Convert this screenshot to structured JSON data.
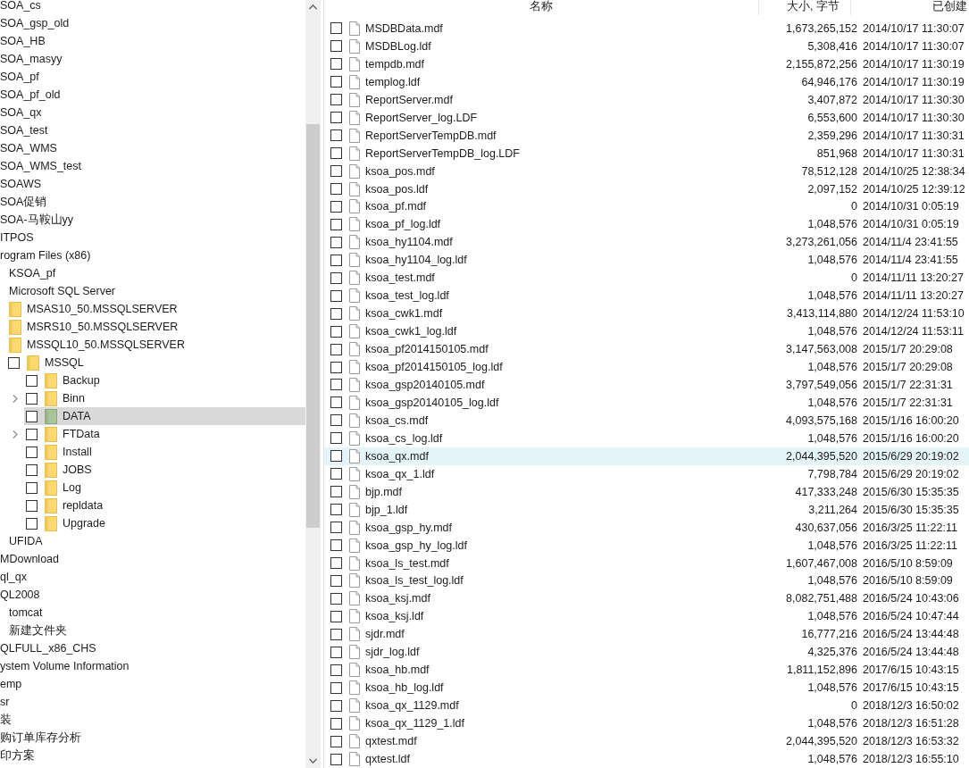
{
  "tree": {
    "items": [
      {
        "label": "SOA_cs",
        "selected": false
      },
      {
        "label": "SOA_gsp_old",
        "selected": false
      },
      {
        "label": "SOA_HB",
        "selected": false
      },
      {
        "label": "SOA_masyy",
        "selected": false
      },
      {
        "label": "SOA_pf",
        "selected": false
      },
      {
        "label": "SOA_pf_old",
        "selected": false
      },
      {
        "label": "SOA_qx",
        "selected": false
      },
      {
        "label": "SOA_test",
        "selected": false
      },
      {
        "label": "SOA_WMS",
        "selected": false
      },
      {
        "label": "SOA_WMS_test",
        "selected": false
      },
      {
        "label": "SOAWS",
        "selected": false
      },
      {
        "label": "SOA促销",
        "selected": false
      },
      {
        "label": "SOA-马鞍山yy",
        "selected": false
      },
      {
        "label": "ITPOS",
        "selected": false
      },
      {
        "label": "rogram Files (x86)",
        "selected": false,
        "children": [
          {
            "label": "KSOA_pf",
            "selected": false
          },
          {
            "label": "Microsoft SQL Server",
            "selected": false,
            "children": [
              {
                "label": "MSAS10_50.MSSQLSERVER",
                "selected": false
              },
              {
                "label": "MSRS10_50.MSSQLSERVER",
                "selected": false
              },
              {
                "label": "MSSQL10_50.MSSQLSERVER",
                "selected": false,
                "children": [
                  {
                    "label": "MSSQL",
                    "selected": false,
                    "checked": false,
                    "children": [
                      {
                        "label": "Backup",
                        "selected": false,
                        "checked": false,
                        "expandable": false
                      },
                      {
                        "label": "Binn",
                        "selected": false,
                        "checked": false,
                        "expandable": true
                      },
                      {
                        "label": "DATA",
                        "selected": true,
                        "checked": false,
                        "expandable": false
                      },
                      {
                        "label": "FTData",
                        "selected": false,
                        "checked": false,
                        "expandable": true
                      },
                      {
                        "label": "Install",
                        "selected": false,
                        "checked": false,
                        "expandable": false
                      },
                      {
                        "label": "JOBS",
                        "selected": false,
                        "checked": false,
                        "expandable": false
                      },
                      {
                        "label": "Log",
                        "selected": false,
                        "checked": false,
                        "expandable": false
                      },
                      {
                        "label": "repldata",
                        "selected": false,
                        "checked": false,
                        "expandable": false
                      },
                      {
                        "label": "Upgrade",
                        "selected": false,
                        "checked": false,
                        "expandable": false
                      }
                    ]
                  }
                ]
              }
            ]
          },
          {
            "label": "UFIDA",
            "selected": false
          }
        ]
      },
      {
        "label": "MDownload",
        "selected": false
      },
      {
        "label": "ql_qx",
        "selected": false
      },
      {
        "label": "QL2008",
        "selected": false,
        "children": [
          {
            "label": "tomcat",
            "selected": false
          },
          {
            "label": "新建文件夹",
            "selected": false
          }
        ]
      },
      {
        "label": "QLFULL_x86_CHS",
        "selected": false
      },
      {
        "label": "ystem Volume Information",
        "selected": false
      },
      {
        "label": "emp",
        "selected": false
      },
      {
        "label": "sr",
        "selected": false
      },
      {
        "label": "装",
        "selected": false
      },
      {
        "label": "购订单库存分析",
        "selected": false
      },
      {
        "label": "印方案",
        "selected": false
      }
    ]
  },
  "file_list": {
    "columns": [
      "名称",
      "大小, 字节",
      "已创建"
    ],
    "rows": [
      {
        "name": "MSDBData.mdf",
        "size": "1,673,265,152",
        "created": "2014/10/17 11:30:07",
        "checked": false,
        "selected": false
      },
      {
        "name": "MSDBLog.ldf",
        "size": "5,308,416",
        "created": "2014/10/17 11:30:07",
        "checked": false,
        "selected": false
      },
      {
        "name": "tempdb.mdf",
        "size": "2,155,872,256",
        "created": "2014/10/17 11:30:19",
        "checked": false,
        "selected": false
      },
      {
        "name": "templog.ldf",
        "size": "64,946,176",
        "created": "2014/10/17 11:30:19",
        "checked": false,
        "selected": false
      },
      {
        "name": "ReportServer.mdf",
        "size": "3,407,872",
        "created": "2014/10/17 11:30:30",
        "checked": false,
        "selected": false
      },
      {
        "name": "ReportServer_log.LDF",
        "size": "6,553,600",
        "created": "2014/10/17 11:30:30",
        "checked": false,
        "selected": false
      },
      {
        "name": "ReportServerTempDB.mdf",
        "size": "2,359,296",
        "created": "2014/10/17 11:30:31",
        "checked": false,
        "selected": false
      },
      {
        "name": "ReportServerTempDB_log.LDF",
        "size": "851,968",
        "created": "2014/10/17 11:30:31",
        "checked": false,
        "selected": false
      },
      {
        "name": "ksoa_pos.mdf",
        "size": "78,512,128",
        "created": "2014/10/25 12:38:34",
        "checked": false,
        "selected": false
      },
      {
        "name": "ksoa_pos.ldf",
        "size": "2,097,152",
        "created": "2014/10/25 12:39:12",
        "checked": false,
        "selected": false
      },
      {
        "name": "ksoa_pf.mdf",
        "size": "0",
        "created": "2014/10/31 0:05:19",
        "checked": false,
        "selected": false
      },
      {
        "name": "ksoa_pf_log.ldf",
        "size": "1,048,576",
        "created": "2014/10/31 0:05:19",
        "checked": false,
        "selected": false
      },
      {
        "name": "ksoa_hy1104.mdf",
        "size": "3,273,261,056",
        "created": "2014/11/4 23:41:55",
        "checked": false,
        "selected": false
      },
      {
        "name": "ksoa_hy1104_log.ldf",
        "size": "1,048,576",
        "created": "2014/11/4 23:41:55",
        "checked": false,
        "selected": false
      },
      {
        "name": "ksoa_test.mdf",
        "size": "0",
        "created": "2014/11/11 13:20:27",
        "checked": false,
        "selected": false
      },
      {
        "name": "ksoa_test_log.ldf",
        "size": "1,048,576",
        "created": "2014/11/11 13:20:27",
        "checked": false,
        "selected": false
      },
      {
        "name": "ksoa_cwk1.mdf",
        "size": "3,413,114,880",
        "created": "2014/12/24 11:53:10",
        "checked": false,
        "selected": false
      },
      {
        "name": "ksoa_cwk1_log.ldf",
        "size": "1,048,576",
        "created": "2014/12/24 11:53:11",
        "checked": false,
        "selected": false
      },
      {
        "name": "ksoa_pf2014150105.mdf",
        "size": "3,147,563,008",
        "created": "2015/1/7 20:29:08",
        "checked": false,
        "selected": false
      },
      {
        "name": "ksoa_pf2014150105_log.ldf",
        "size": "1,048,576",
        "created": "2015/1/7 20:29:08",
        "checked": false,
        "selected": false
      },
      {
        "name": "ksoa_gsp20140105.mdf",
        "size": "3,797,549,056",
        "created": "2015/1/7 22:31:31",
        "checked": false,
        "selected": false
      },
      {
        "name": "ksoa_gsp20140105_log.ldf",
        "size": "1,048,576",
        "created": "2015/1/7 22:31:31",
        "checked": false,
        "selected": false
      },
      {
        "name": "ksoa_cs.mdf",
        "size": "4,093,575,168",
        "created": "2015/1/16 16:00:20",
        "checked": false,
        "selected": false
      },
      {
        "name": "ksoa_cs_log.ldf",
        "size": "1,048,576",
        "created": "2015/1/16 16:00:20",
        "checked": false,
        "selected": false
      },
      {
        "name": "ksoa_qx.mdf",
        "size": "2,044,395,520",
        "created": "2015/6/29 20:19:02",
        "checked": false,
        "selected": true
      },
      {
        "name": "ksoa_qx_1.ldf",
        "size": "7,798,784",
        "created": "2015/6/29 20:19:02",
        "checked": false,
        "selected": false
      },
      {
        "name": "bjp.mdf",
        "size": "417,333,248",
        "created": "2015/6/30 15:35:35",
        "checked": false,
        "selected": false
      },
      {
        "name": "bjp_1.ldf",
        "size": "3,211,264",
        "created": "2015/6/30 15:35:35",
        "checked": false,
        "selected": false
      },
      {
        "name": "ksoa_gsp_hy.mdf",
        "size": "430,637,056",
        "created": "2016/3/25 11:22:11",
        "checked": false,
        "selected": false
      },
      {
        "name": "ksoa_gsp_hy_log.ldf",
        "size": "1,048,576",
        "created": "2016/3/25 11:22:11",
        "checked": false,
        "selected": false
      },
      {
        "name": "ksoa_ls_test.mdf",
        "size": "1,607,467,008",
        "created": "2016/5/10 8:59:09",
        "checked": false,
        "selected": false
      },
      {
        "name": "ksoa_ls_test_log.ldf",
        "size": "1,048,576",
        "created": "2016/5/10 8:59:09",
        "checked": false,
        "selected": false
      },
      {
        "name": "ksoa_ksj.mdf",
        "size": "8,082,751,488",
        "created": "2016/5/24 10:43:06",
        "checked": false,
        "selected": false
      },
      {
        "name": "ksoa_ksj.ldf",
        "size": "1,048,576",
        "created": "2016/5/24 10:47:44",
        "checked": false,
        "selected": false
      },
      {
        "name": "sjdr.mdf",
        "size": "16,777,216",
        "created": "2016/5/24 13:44:48",
        "checked": false,
        "selected": false
      },
      {
        "name": "sjdr_log.ldf",
        "size": "4,325,376",
        "created": "2016/5/24 13:44:48",
        "checked": false,
        "selected": false
      },
      {
        "name": "ksoa_hb.mdf",
        "size": "1,811,152,896",
        "created": "2017/6/15 10:43:15",
        "checked": false,
        "selected": false
      },
      {
        "name": "ksoa_hb_log.ldf",
        "size": "1,048,576",
        "created": "2017/6/15 10:43:15",
        "checked": false,
        "selected": false
      },
      {
        "name": "ksoa_qx_1129.mdf",
        "size": "0",
        "created": "2018/12/3 16:50:02",
        "checked": false,
        "selected": false
      },
      {
        "name": "ksoa_qx_1129_1.ldf",
        "size": "1,048,576",
        "created": "2018/12/3 16:51:28",
        "checked": false,
        "selected": false
      },
      {
        "name": "qxtest.mdf",
        "size": "2,044,395,520",
        "created": "2018/12/3 16:53:32",
        "checked": false,
        "selected": false
      },
      {
        "name": "qxtest.ldf",
        "size": "1,048,576",
        "created": "2018/12/3 16:55:10",
        "checked": false,
        "selected": false
      }
    ]
  }
}
